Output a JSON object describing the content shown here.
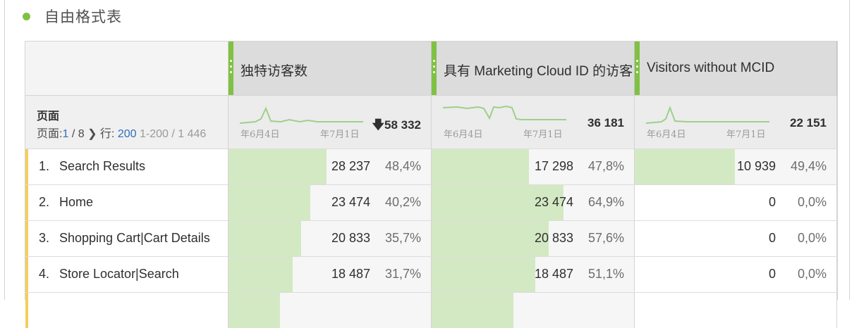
{
  "panel": {
    "title": "自由格式表"
  },
  "dimension": {
    "title": "页面",
    "pager_label": "页面:",
    "page_current": "1",
    "page_total": "/ 8",
    "next_icon": "chevron-right-icon",
    "rows_label": "行:",
    "rows_value": "200",
    "range": "1-200 / 1 446"
  },
  "columns": [
    {
      "label": "独特访客数",
      "total": "58 332",
      "sort_icon": "arrow-down-icon",
      "date_start": "年6月4日",
      "date_end": "年7月1日"
    },
    {
      "label": "具有 Marketing Cloud ID 的访客",
      "total": "36 181",
      "date_start": "年6月4日",
      "date_end": "年7月1日"
    },
    {
      "label": "Visitors without MCID",
      "total": "22 151",
      "date_start": "年6月4日",
      "date_end": "年7月1日"
    }
  ],
  "rows": [
    {
      "num": "1.",
      "name": "Search Results",
      "cells": [
        {
          "value": "28 237",
          "pct": "48,4%",
          "fill": 0.484
        },
        {
          "value": "17 298",
          "pct": "47,8%",
          "fill": 0.478
        },
        {
          "value": "10 939",
          "pct": "49,4%",
          "fill": 0.494
        }
      ]
    },
    {
      "num": "2.",
      "name": "Home",
      "cells": [
        {
          "value": "23 474",
          "pct": "40,2%",
          "fill": 0.402
        },
        {
          "value": "23 474",
          "pct": "64,9%",
          "fill": 0.649
        },
        {
          "value": "0",
          "pct": "0,0%",
          "fill": 0
        }
      ]
    },
    {
      "num": "3.",
      "name": "Shopping Cart|Cart Details",
      "cells": [
        {
          "value": "20 833",
          "pct": "35,7%",
          "fill": 0.357
        },
        {
          "value": "20 833",
          "pct": "57,6%",
          "fill": 0.576
        },
        {
          "value": "0",
          "pct": "0,0%",
          "fill": 0
        }
      ]
    },
    {
      "num": "4.",
      "name": "Store Locator|Search",
      "cells": [
        {
          "value": "18 487",
          "pct": "31,7%",
          "fill": 0.317
        },
        {
          "value": "18 487",
          "pct": "51,1%",
          "fill": 0.511
        },
        {
          "value": "0",
          "pct": "0,0%",
          "fill": 0
        }
      ]
    }
  ],
  "colors": {
    "accent": "#7fc142",
    "bar_fill": "#d3e9c3",
    "row_marker": "#f5ce5b",
    "link": "#2d6fbd"
  }
}
